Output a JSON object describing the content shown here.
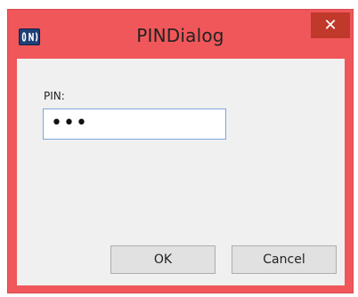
{
  "window": {
    "title": "PINDialog",
    "close_glyph": "✕",
    "icon": "app-logo-icon"
  },
  "form": {
    "pin_label": "PIN:",
    "pin_value": "•••"
  },
  "buttons": {
    "ok_label": "OK",
    "cancel_label": "Cancel"
  },
  "colors": {
    "frame": "#f0575a",
    "close_button": "#c0392b",
    "client_bg": "#f0f0f0",
    "input_border": "#7aa7d8"
  }
}
